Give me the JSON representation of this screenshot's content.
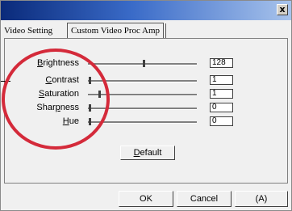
{
  "window": {
    "close_label": "x"
  },
  "tabs": [
    {
      "label": "Video Setting"
    },
    {
      "label": "Custom Video Proc Amp"
    }
  ],
  "sliders": [
    {
      "label_pre": "",
      "label_acc": "B",
      "label_post": "rightness",
      "value": "128",
      "level": 0.5
    },
    {
      "label_pre": "",
      "label_acc": "C",
      "label_post": "ontrast",
      "value": "1",
      "level": 0.0
    },
    {
      "label_pre": "",
      "label_acc": "S",
      "label_post": "aturation",
      "value": "1",
      "level": 0.1
    },
    {
      "label_pre": "Shar",
      "label_acc": "p",
      "label_post": "ness",
      "value": "0",
      "level": 0.0
    },
    {
      "label_pre": "",
      "label_acc": "H",
      "label_post": "ue",
      "value": "0",
      "level": 0.0
    }
  ],
  "buttons": {
    "default_pre": "",
    "default_acc": "D",
    "default_post": "efault",
    "ok": "OK",
    "cancel": "Cancel",
    "apply": "(A)"
  },
  "annotation": {
    "circle_color": "#d42a3a"
  }
}
